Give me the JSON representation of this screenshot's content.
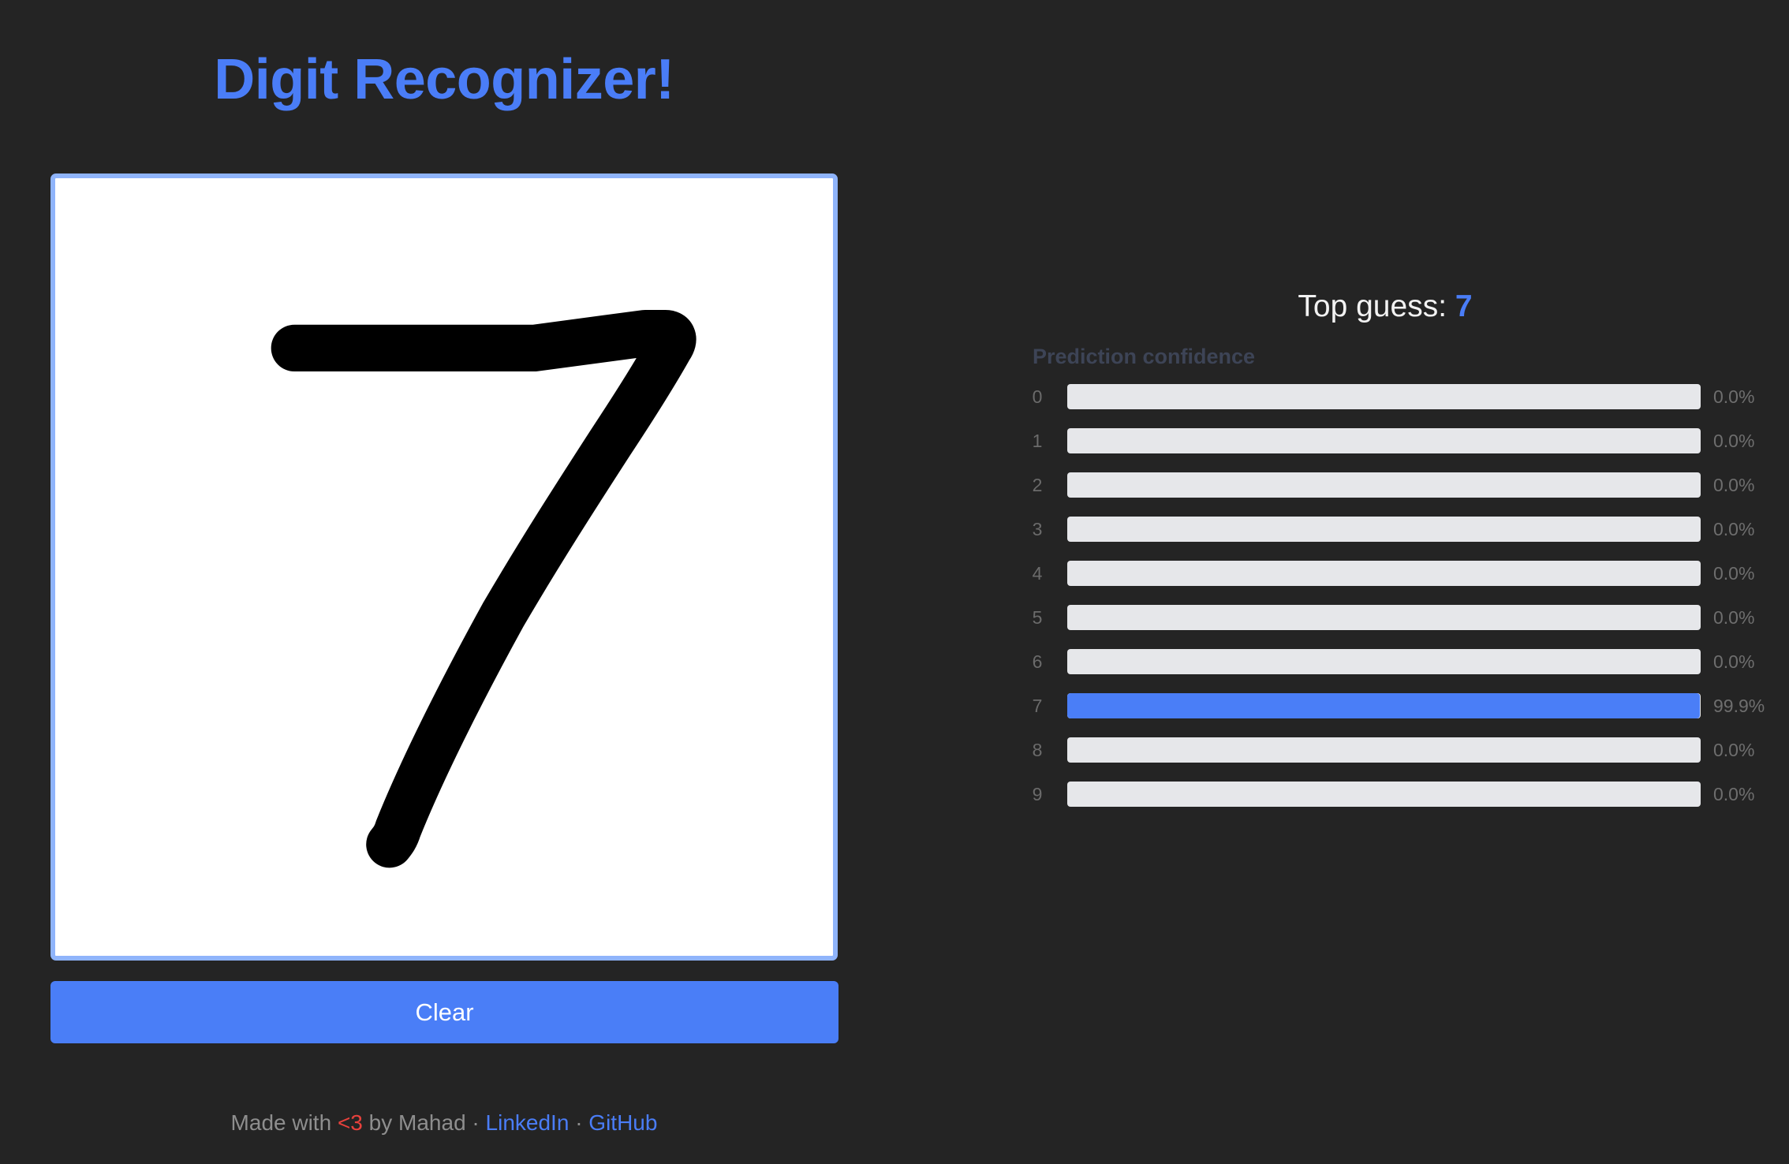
{
  "header": {
    "title": "Digit Recognizer!",
    "title_color": "#4a7df7"
  },
  "canvas": {
    "drawn_content": "handwritten digit 7 (black stroke on white)",
    "border_color": "#8fb4fb"
  },
  "actions": {
    "clear_label": "Clear",
    "accent_color": "#4a7ef7"
  },
  "results": {
    "top_guess_label": "Top guess:",
    "top_guess_value": "7",
    "confidence_title": "Prediction confidence",
    "rows": [
      {
        "digit": "0",
        "value": "0.0%",
        "fraction": 0.0
      },
      {
        "digit": "1",
        "value": "0.0%",
        "fraction": 0.0
      },
      {
        "digit": "2",
        "value": "0.0%",
        "fraction": 0.0
      },
      {
        "digit": "3",
        "value": "0.0%",
        "fraction": 0.0
      },
      {
        "digit": "4",
        "value": "0.0%",
        "fraction": 0.0
      },
      {
        "digit": "5",
        "value": "0.0%",
        "fraction": 0.0
      },
      {
        "digit": "6",
        "value": "0.0%",
        "fraction": 0.0
      },
      {
        "digit": "7",
        "value": "99.9%",
        "fraction": 0.999
      },
      {
        "digit": "8",
        "value": "0.0%",
        "fraction": 0.0
      },
      {
        "digit": "9",
        "value": "0.0%",
        "fraction": 0.0
      }
    ]
  },
  "footer": {
    "made_with": "Made with",
    "heart": "<3",
    "by": "by Mahad",
    "separator": "·",
    "linkedin": "LinkedIn",
    "github": "GitHub",
    "heart_color": "#e8413c"
  }
}
